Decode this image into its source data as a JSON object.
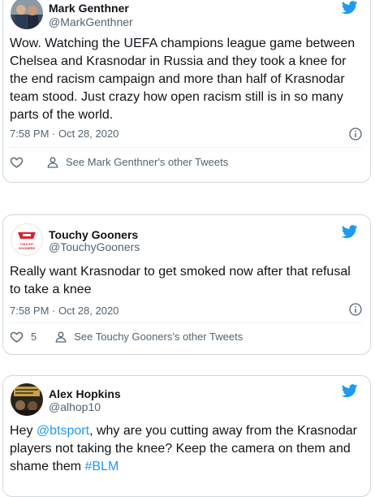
{
  "tweets": [
    {
      "name": "Mark Genthner",
      "handle": "@MarkGenthner",
      "text_parts": [
        "Wow. Watching the UEFA champions league game between Chelsea and Krasnodar in Russia and they took a knee for the end racism campaign and more than half of Krasnodar team stood. Just crazy how open racism still is in so many parts of the world."
      ],
      "timestamp": "7:58 PM · Oct 28, 2020",
      "likes": "",
      "profile_link": "See Mark Genthner's other Tweets"
    },
    {
      "name": "Touchy Gooners",
      "handle": "@TouchyGooners",
      "avatar_text": "TOUCHY GOONERS",
      "text_parts": [
        "Really want Krasnodar to get smoked now after that refusal to take a knee"
      ],
      "timestamp": "7:58 PM · Oct 28, 2020",
      "likes": "5",
      "profile_link": "See Touchy Gooners's other Tweets"
    },
    {
      "name": "Alex Hopkins",
      "handle": "@alhop10",
      "text_pre": "Hey ",
      "mention": "@btsport",
      "text_mid": ", why are you cutting away from the Krasnodar players not taking the knee? Keep the camera on them and shame them ",
      "hashtag": "#BLM"
    }
  ],
  "colors": {
    "accent": "#1d9bf0",
    "text": "#0f1419",
    "muted": "#536471",
    "border": "#cfd9de"
  },
  "icons": [
    "twitter-bird-icon",
    "info-icon",
    "heart-icon",
    "person-icon"
  ]
}
